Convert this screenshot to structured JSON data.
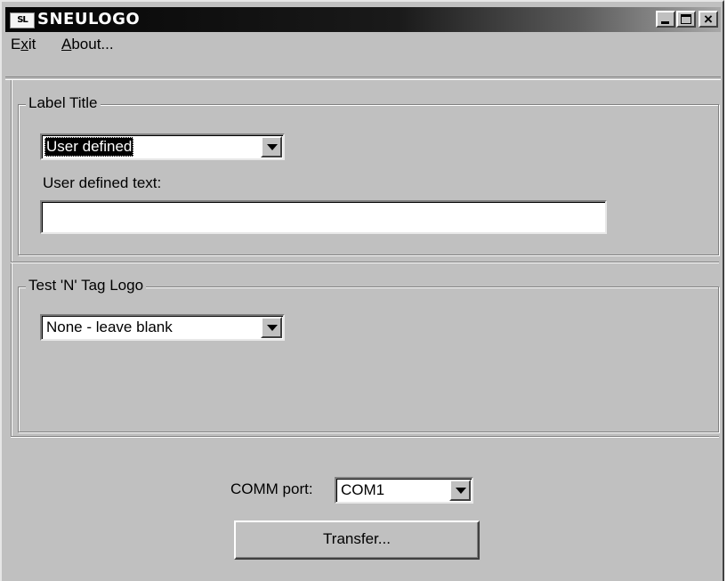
{
  "window": {
    "title": "SNEULOGO",
    "icon_text": "SL",
    "controls": [
      "minimize-icon",
      "maximize-icon",
      "close-icon"
    ]
  },
  "menu": {
    "items": [
      {
        "label": "Exit",
        "accel": "x"
      },
      {
        "label": "About...",
        "accel": "A"
      }
    ]
  },
  "label_title": {
    "group_label": "Label Title",
    "selected": "User defined",
    "user_text_label": "User defined text:",
    "user_text_value": ""
  },
  "logo": {
    "group_label": "Test 'N' Tag Logo",
    "selected": "None - leave blank"
  },
  "comm": {
    "label": "COMM port:",
    "selected": "COM1"
  },
  "transfer": {
    "label": "Transfer..."
  }
}
